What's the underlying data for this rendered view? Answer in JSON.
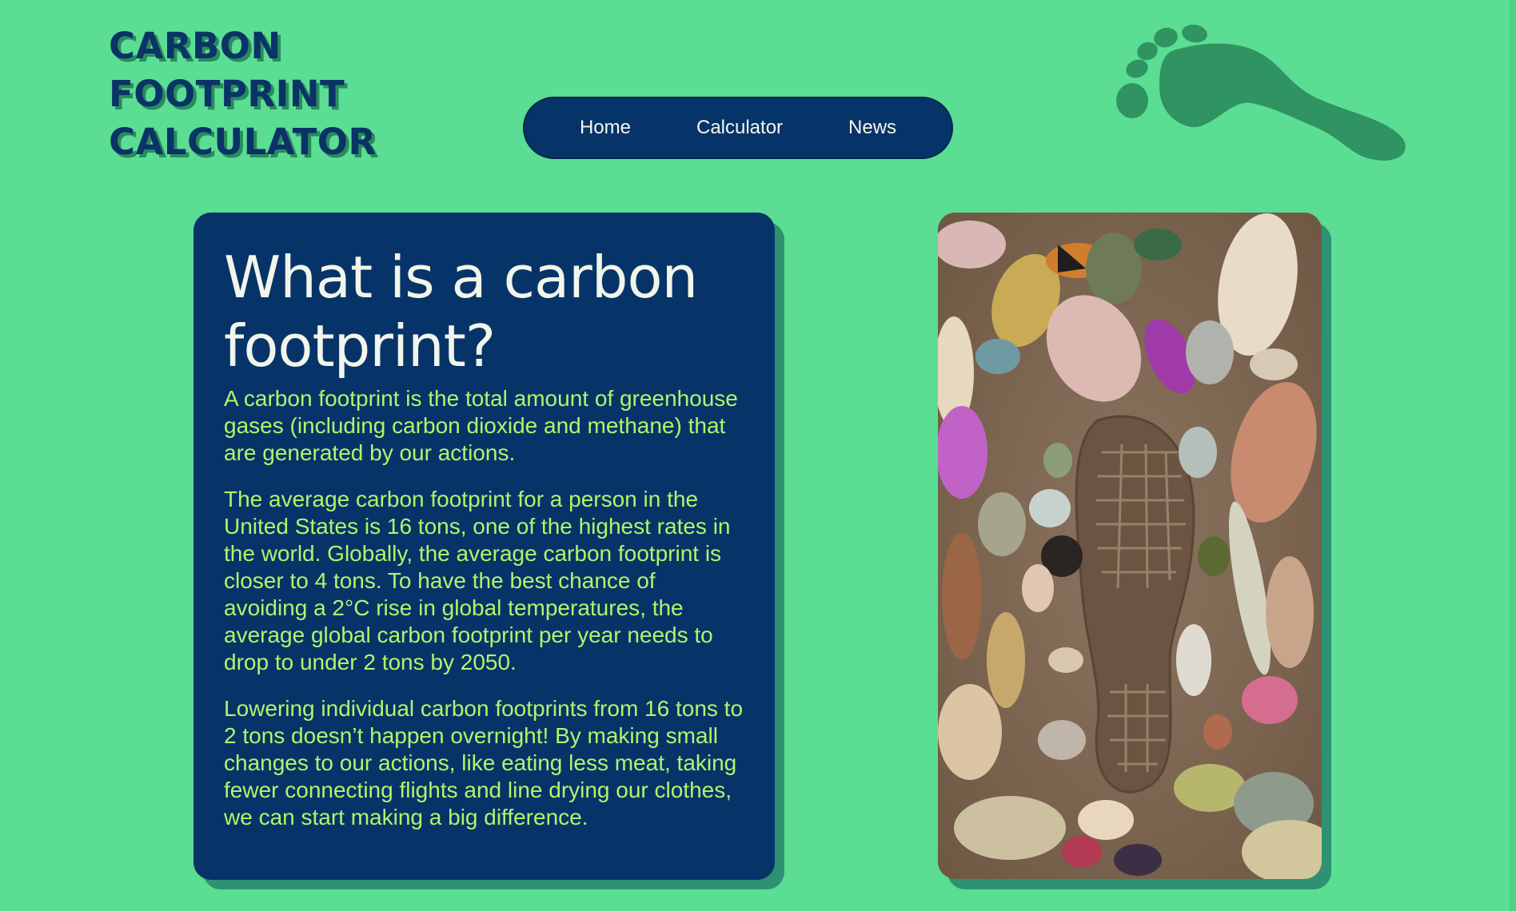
{
  "logo": {
    "line1": "CARBON",
    "line2": "FOOTPRINT",
    "line3": "CALCULATOR"
  },
  "nav": {
    "items": [
      {
        "label": "Home"
      },
      {
        "label": "Calculator"
      },
      {
        "label": "News"
      }
    ]
  },
  "card": {
    "heading": "What is a carbon footprint?",
    "paragraphs": [
      "A carbon footprint is the total amount of greenhouse gases (including carbon dioxide and methane) that are generated by our actions.",
      "The average carbon footprint for a person in the United States is 16 tons, one of the highest rates in the world. Globally, the average carbon footprint is closer to 4 tons. To have the best chance of avoiding a 2°C rise in global temperatures, the average global carbon footprint per year needs to drop to under 2 tons by 2050.",
      "Lowering individual carbon footprints from 16 tons to 2 tons doesn’t happen overnight! By making small changes to our actions, like eating less meat, taking fewer connecting flights and line drying our clothes, we can start making a big difference."
    ]
  },
  "icons": {
    "footprint": "footprint-icon"
  },
  "colors": {
    "background": "#5bdd93",
    "navy": "#063469",
    "accent_text": "#b3f36a",
    "heading_text": "#f2f5ea",
    "shadow": "#2e9272",
    "footprint": "#2a8a5e"
  }
}
